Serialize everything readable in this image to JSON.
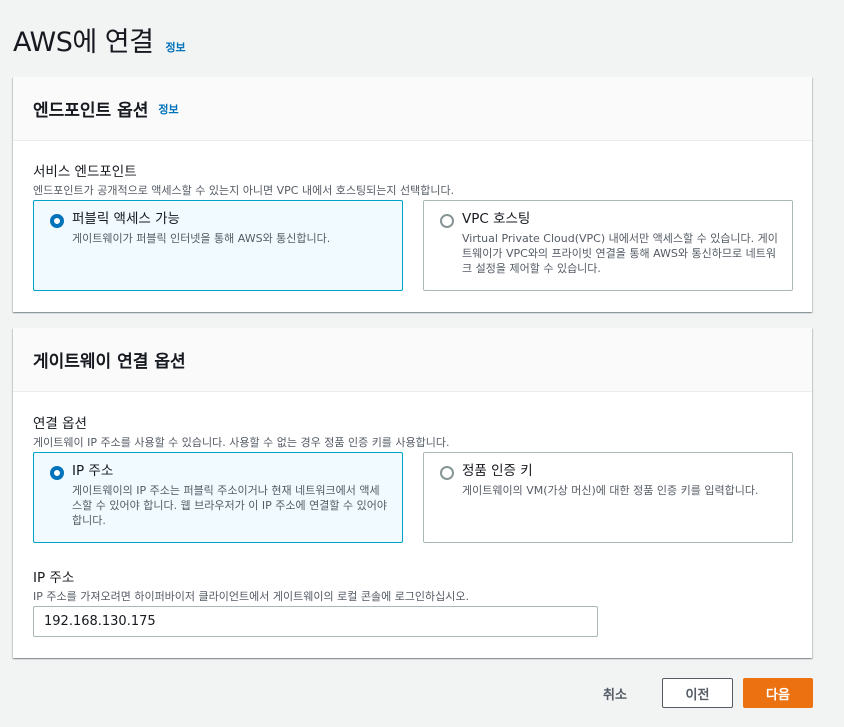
{
  "header": {
    "title": "AWS에 연결",
    "info": "정보"
  },
  "endpoint_panel": {
    "title": "엔드포인트 옵션",
    "info": "정보",
    "field_label": "서비스 엔드포인트",
    "field_desc": "엔드포인트가 공개적으로 액세스할 수 있는지 아니면 VPC 내에서 호스팅되는지 선택합니다.",
    "options": [
      {
        "title": "퍼블릭 액세스 가능",
        "desc": "게이트웨이가 퍼블릭 인터넷을 통해 AWS와 통신합니다.",
        "selected": true
      },
      {
        "title": "VPC 호스팅",
        "desc": "Virtual Private Cloud(VPC) 내에서만 액세스할 수 있습니다. 게이트웨이가 VPC와의 프라이빗 연결을 통해 AWS와 통신하므로 네트워크 설정을 제어할 수 있습니다.",
        "selected": false
      }
    ]
  },
  "connection_panel": {
    "title": "게이트웨이 연결 옵션",
    "field_label": "연결 옵션",
    "field_desc": "게이트웨이 IP 주소를 사용할 수 있습니다. 사용할 수 없는 경우 정품 인증 키를 사용합니다.",
    "options": [
      {
        "title": "IP 주소",
        "desc": "게이트웨이의 IP 주소는 퍼블릭 주소이거나 현재 네트워크에서 액세스할 수 있어야 합니다. 웹 브라우저가 이 IP 주소에 연결할 수 있어야 합니다.",
        "selected": true
      },
      {
        "title": "정품 인증 키",
        "desc": "게이트웨이의 VM(가상 머신)에 대한 정품 인증 키를 입력합니다.",
        "selected": false
      }
    ],
    "ip_label": "IP 주소",
    "ip_desc": "IP 주소를 가져오려면 하이퍼바이저 클라이언트에서 게이트웨이의 로컬 콘솔에 로그인하십시오.",
    "ip_value": "192.168.130.175"
  },
  "footer": {
    "cancel": "취소",
    "previous": "이전",
    "next": "다음"
  },
  "colors": {
    "accent": "#0073bb",
    "primary_button": "#ec7211",
    "selected_border": "#00a1c9"
  }
}
